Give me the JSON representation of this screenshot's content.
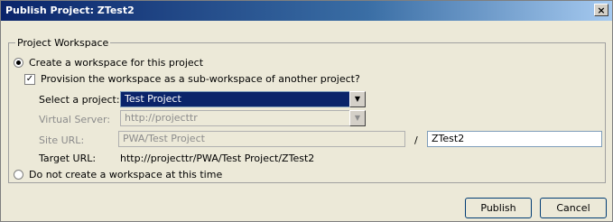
{
  "window": {
    "title": "Publish Project: ZTest2",
    "close_glyph": "×"
  },
  "group": {
    "legend": "Project Workspace"
  },
  "create_option": {
    "label": "Create a workspace for this project",
    "selected": true
  },
  "provision_option": {
    "label": "Provision the workspace as a sub-workspace of another project?",
    "checked": true
  },
  "select_project": {
    "label": "Select a project:",
    "value": "Test Project"
  },
  "virtual_server": {
    "label": "Virtual Server:",
    "value": "http://projecttr"
  },
  "site_url": {
    "label": "Site URL:",
    "value": "PWA/Test Project",
    "separator": "/",
    "suffix": "ZTest2"
  },
  "target_url": {
    "label": "Target URL:",
    "value": "http://projecttr/PWA/Test Project/ZTest2"
  },
  "no_workspace_option": {
    "label": "Do not create a workspace at this time",
    "selected": false
  },
  "buttons": {
    "publish": "Publish",
    "cancel": "Cancel"
  }
}
